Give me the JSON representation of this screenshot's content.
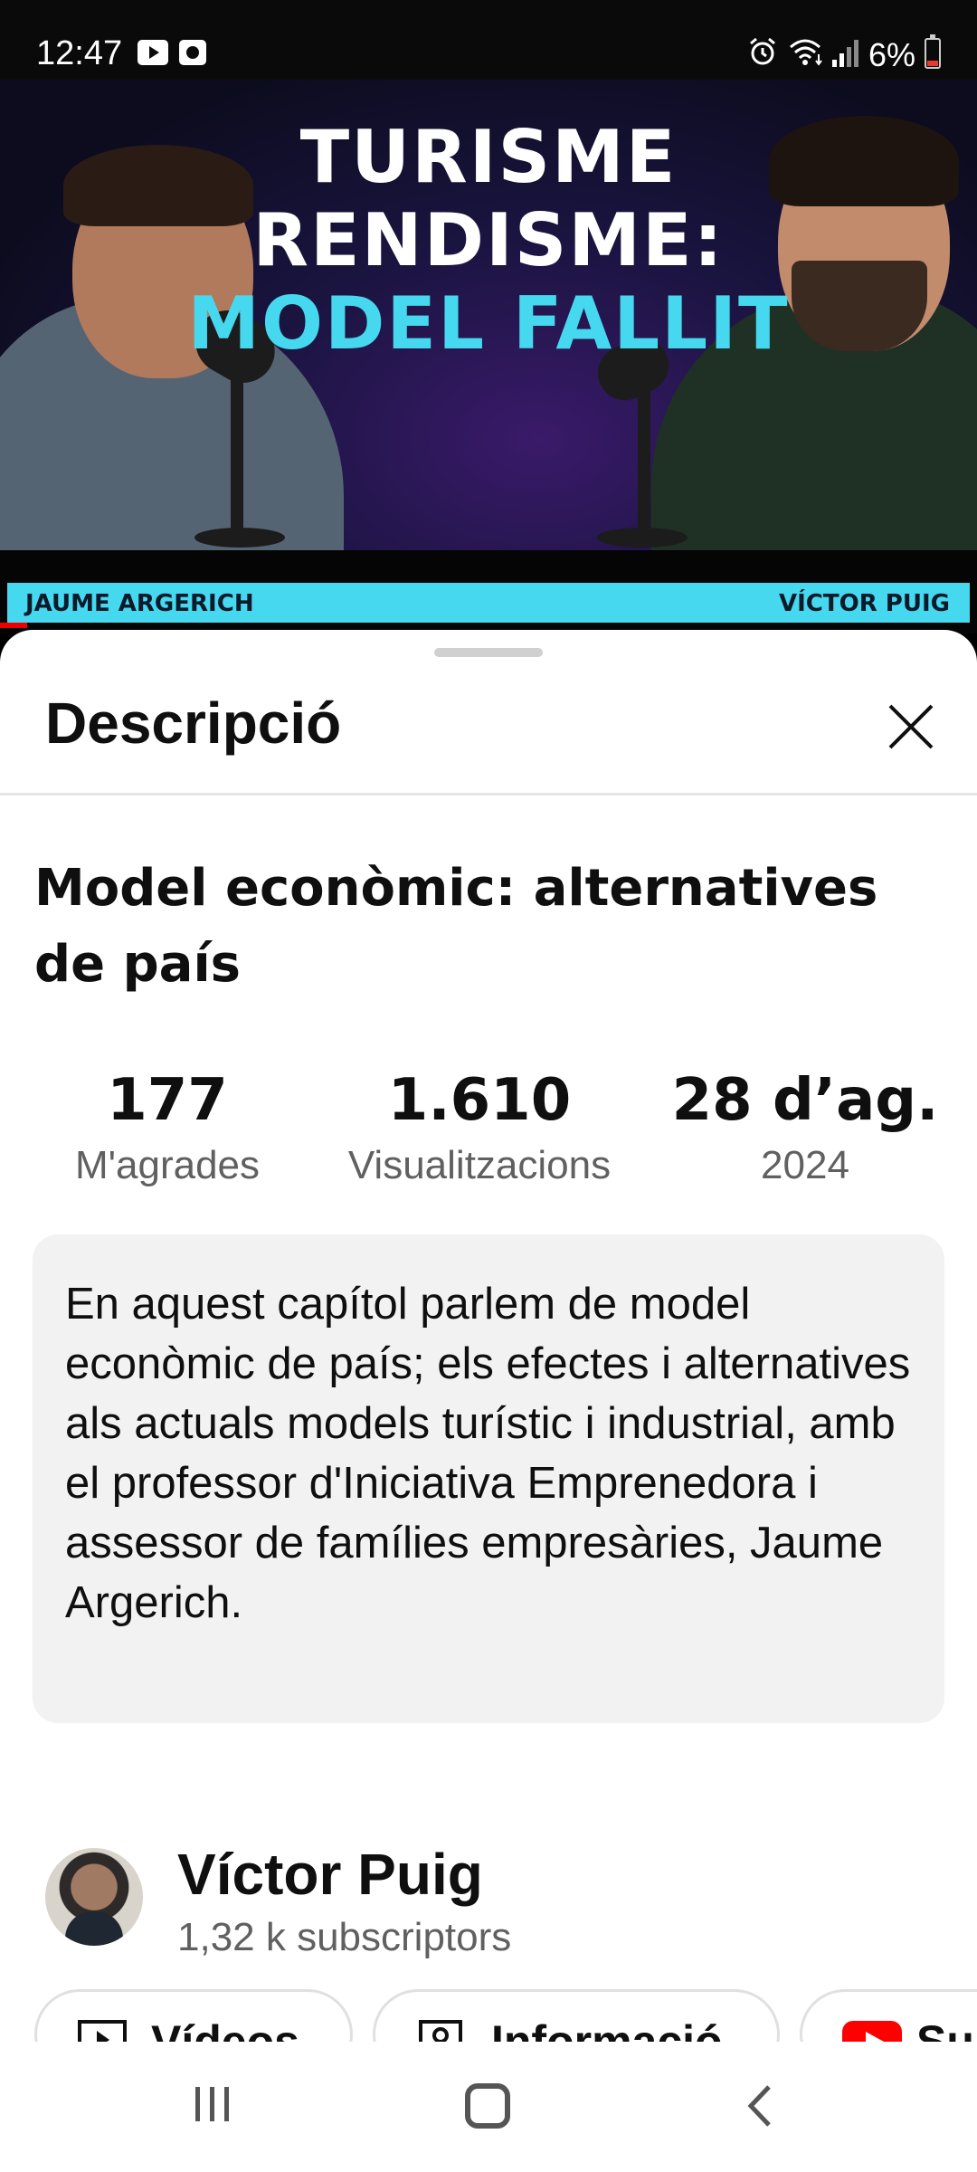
{
  "status_bar": {
    "time": "12:47",
    "battery_percent": "6%",
    "notification_icons": [
      "youtube-icon",
      "screen-record-icon"
    ],
    "system_icons": [
      "alarm-icon",
      "wifi-icon",
      "signal-icon",
      "battery-icon"
    ]
  },
  "video": {
    "title_lines": [
      "TURISME",
      "RENDISME:",
      "MODEL FALLIT"
    ],
    "accent_color": "#46d8ef",
    "name_left": "JAUME ARGERICH",
    "name_right": "VÍCTOR PUIG"
  },
  "sheet": {
    "title": "Descripció",
    "video_title": "Model econòmic: alternatives de país",
    "stats": {
      "likes_value": "177",
      "likes_label": "M'agrades",
      "views_value": "1.610",
      "views_label": "Visualitzacions",
      "date_value": "28 d’ag.",
      "date_year": "2024"
    },
    "description": "En aquest capítol parlem de model econòmic de país; els efectes i alternatives als actuals models turístic i industrial, amb el professor d'Iniciativa Emprenedora i assessor de famílies empresàries, Jaume Argerich.",
    "channel": {
      "name": "Víctor Puig",
      "subscribers": "1,32 k subscriptors"
    },
    "chips": [
      {
        "label": "Vídeos",
        "icon": "video-play-icon"
      },
      {
        "label": "Informació",
        "icon": "person-info-icon"
      },
      {
        "label": "Subscriu-te",
        "icon": "youtube-logo-icon"
      }
    ]
  },
  "nav_bar": {
    "buttons": [
      "recent-apps",
      "home",
      "back"
    ]
  }
}
